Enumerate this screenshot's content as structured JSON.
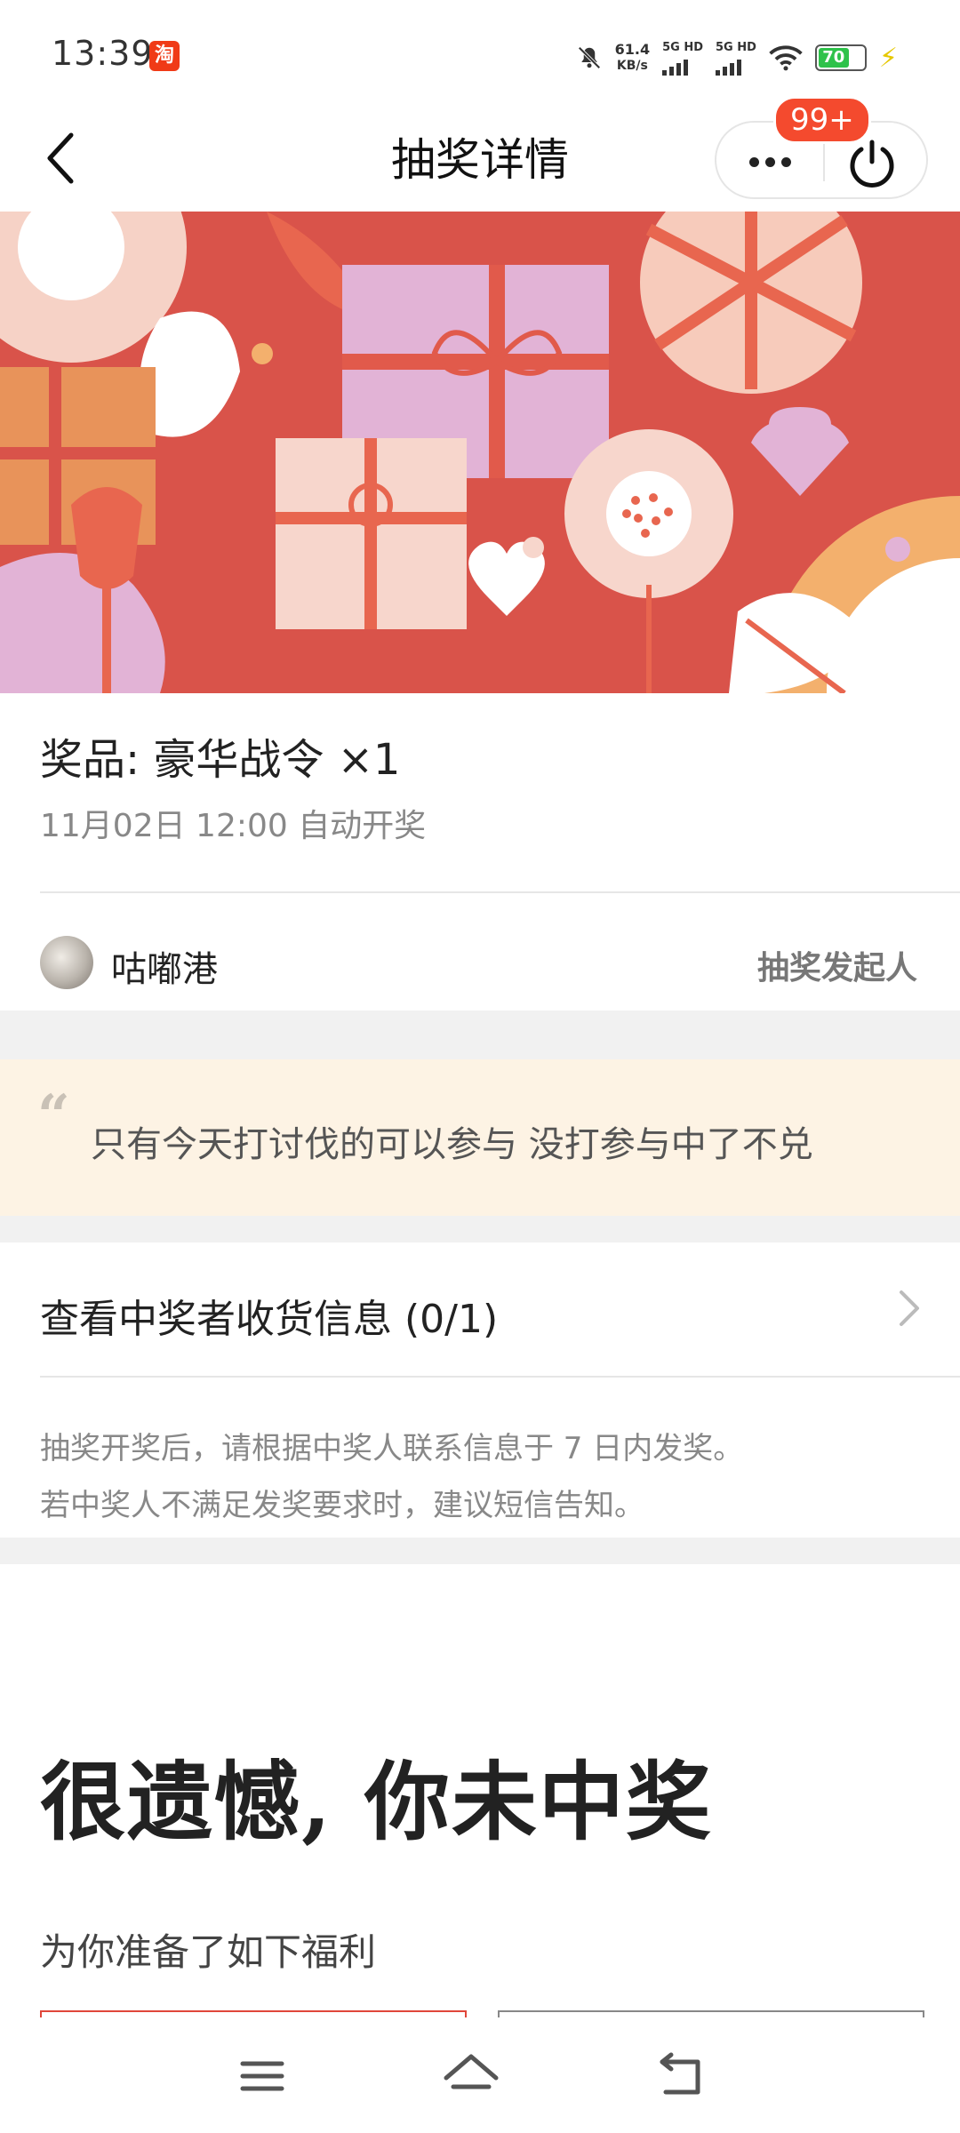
{
  "status_bar": {
    "time": "13:39",
    "app_badge_glyph": "淘",
    "net_speed_value": "61.4",
    "net_speed_unit": "KB/s",
    "sim1": "5G HD",
    "sim2": "5G HD",
    "battery": "70",
    "icons": [
      "mute-bell-icon",
      "signal-icon",
      "wifi-icon",
      "battery-icon",
      "charging-icon"
    ]
  },
  "header": {
    "title": "抽奖详情",
    "badge": "99+"
  },
  "prize": {
    "title": "奖品: 豪华战令 ×1",
    "time": "11月02日 12:00 自动开奖"
  },
  "host": {
    "name": "咕嘟港",
    "role": "抽奖发起人"
  },
  "quote": {
    "text": "只有今天打讨伐的可以参与 没打参与中了不兑"
  },
  "winner_info": {
    "label": "查看中奖者收货信息 (0/1)"
  },
  "note": {
    "line1": "抽奖开奖后，请根据中奖人联系信息于 7 日内发奖。",
    "line2": "若中奖人不满足发奖要求时，建议短信告知。"
  },
  "result": {
    "title": "很遗憾, 你未中奖",
    "welfare_label": "为你准备了如下福利"
  },
  "colors": {
    "accent": "#f44a2e",
    "banner_bg": "#d9534a",
    "quote_bg": "#fdf3e4"
  }
}
